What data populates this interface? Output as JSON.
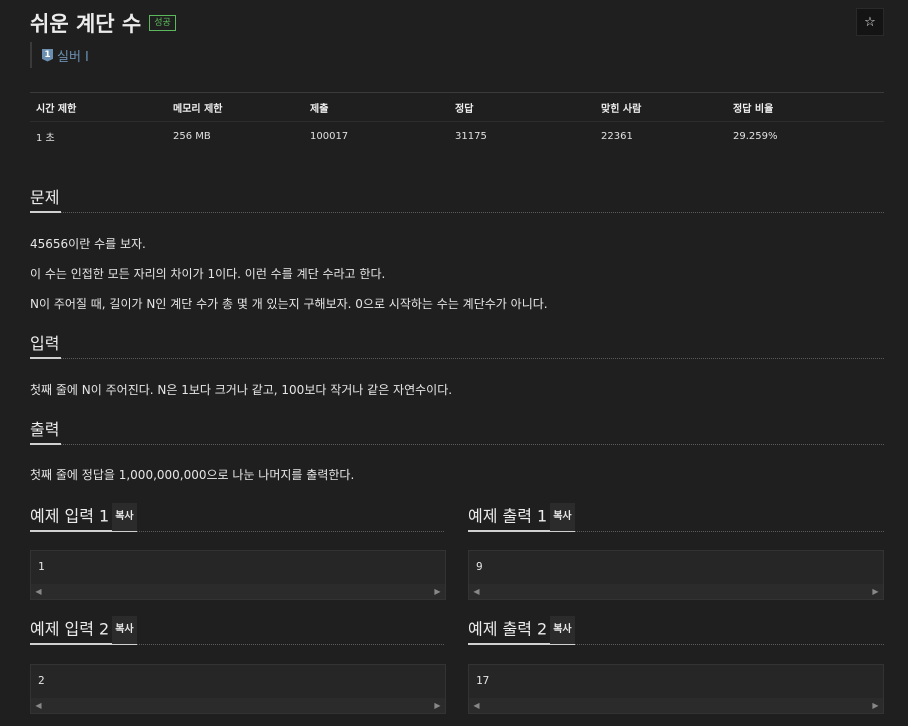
{
  "problem": {
    "title": "쉬운 계단 수",
    "status_badge": "성공",
    "star_icon": "☆",
    "tier": {
      "icon_text": "1",
      "label": "실버 I"
    }
  },
  "info_table": {
    "headers": [
      "시간 제한",
      "메모리 제한",
      "제출",
      "정답",
      "맞힌 사람",
      "정답 비율"
    ],
    "values": [
      "1 초",
      "256 MB",
      "100017",
      "31175",
      "22361",
      "29.259%"
    ]
  },
  "sections": {
    "problem": {
      "heading": "문제",
      "paragraphs": [
        "45656이란 수를 보자.",
        "이 수는 인접한 모든 자리의 차이가 1이다. 이런 수를 계단 수라고 한다.",
        "N이 주어질 때, 길이가 N인 계단 수가 총 몇 개 있는지 구해보자. 0으로 시작하는 수는 계단수가 아니다."
      ]
    },
    "input": {
      "heading": "입력",
      "text": "첫째 줄에 N이 주어진다. N은 1보다 크거나 같고, 100보다 작거나 같은 자연수이다."
    },
    "output": {
      "heading": "출력",
      "text": "첫째 줄에 정답을 1,000,000,000으로 나눈 나머지를 출력한다."
    }
  },
  "examples": {
    "copy_label": "복사",
    "input1": {
      "title": "예제 입력 1",
      "value": "1"
    },
    "output1": {
      "title": "예제 출력 1",
      "value": "9"
    },
    "input2": {
      "title": "예제 입력 2",
      "value": "2"
    },
    "output2": {
      "title": "예제 출력 2",
      "value": "17"
    }
  },
  "colors": {
    "background": "#1f1f1f",
    "success": "#5cb85c",
    "tier_silver": "#6b8fb0"
  },
  "icons": {
    "star": "star-icon",
    "tier": "silver-tier-icon",
    "scroll_left": "scroll-left-arrow-icon",
    "scroll_right": "scroll-right-arrow-icon"
  }
}
